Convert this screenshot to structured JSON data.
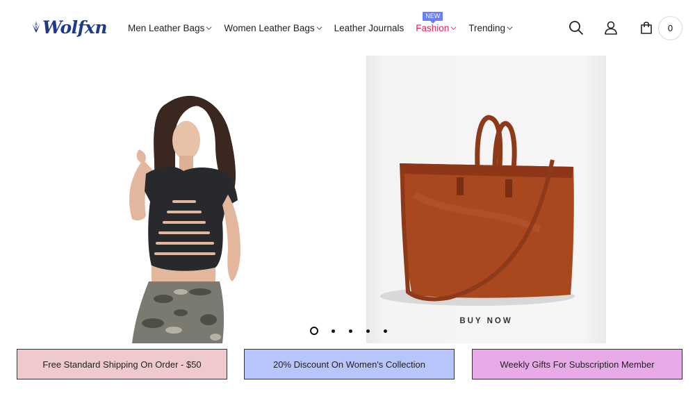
{
  "brand": {
    "name": "Wolfxn"
  },
  "nav": {
    "items": [
      {
        "label": "Men Leather Bags",
        "has_dropdown": true
      },
      {
        "label": "Women Leather Bags",
        "has_dropdown": true
      },
      {
        "label": "Leather Journals",
        "has_dropdown": false
      },
      {
        "label": "Fashion",
        "has_dropdown": true,
        "badge": "NEW"
      },
      {
        "label": "Trending",
        "has_dropdown": true
      }
    ]
  },
  "header_icons": {
    "search": "search-icon",
    "account": "user-icon",
    "cart": "shopping-bag-icon",
    "cart_count": "0"
  },
  "hero": {
    "cta": "BUY NOW",
    "slides_total": 5,
    "active_slide": 1
  },
  "promos": [
    {
      "text": "Free Standard Shipping On Order - $50",
      "color": "#f0c9cc"
    },
    {
      "text": "20% Discount On Women's Collection",
      "color": "#b8c5fb"
    },
    {
      "text": "Weekly Gifts For Subscription Member",
      "color": "#e9aae9"
    }
  ],
  "colors": {
    "brand": "#1e3a8a",
    "accent": "#e0245e",
    "badge": "#6b80f4"
  }
}
